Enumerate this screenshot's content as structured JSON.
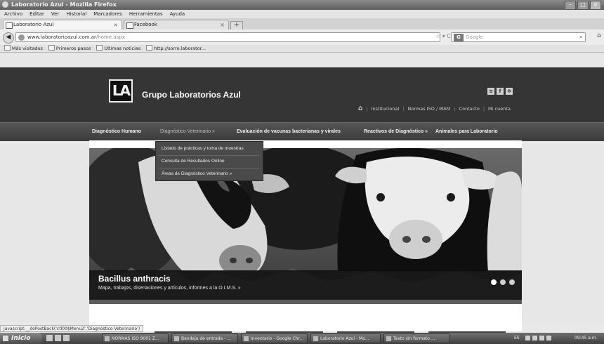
{
  "window": {
    "title": "Laboratorio Azul - Mozilla Firefox"
  },
  "menu": [
    "Archivo",
    "Editar",
    "Ver",
    "Historial",
    "Marcadores",
    "Herramientas",
    "Ayuda"
  ],
  "tabs": [
    {
      "label": "Laboratorio Azul"
    },
    {
      "label": "Facebook"
    }
  ],
  "address": {
    "host": "www.laboratorioazul.com.ar",
    "path": "/home.aspx"
  },
  "search": {
    "placeholder": "Google",
    "engine": "G"
  },
  "bookmarks": [
    "Más visitados",
    "Primeros pasos",
    "Últimas noticias",
    "http://sorro.laborator..."
  ],
  "site": {
    "brand": "Grupo Laboratorios Azul",
    "logo": "LA",
    "top_links": [
      "Institucional",
      "Normas ISO / IRAM",
      "Contacto",
      "Mi cuenta"
    ],
    "nav": [
      "Diagnóstico Humano",
      "Diagnóstico Veterinario »",
      "Evaluación de vacunas bacterianas y virales",
      "Reactivos de Diagnóstico »",
      "Animales para Laboratorio"
    ],
    "dropdown": [
      "Listado de prácticas y toma de muestras",
      "Consulta de Resultados Online",
      "Áreas de Diagnóstico Veterinario »"
    ],
    "slide": {
      "title": "Bacillus anthracis",
      "subtitle": "Mapa, trabajos, disertaciones y artículos, informes a la O.I.M.S. »",
      "dots": 3,
      "active_dot": 1
    }
  },
  "status": {
    "text": "javascript:__doPostBack('ctl00$Menu2','Diagnóstico Veterinario')"
  },
  "taskbar": {
    "start": "Inicio",
    "buttons": [
      "NORMAS ISO 9001 Z...",
      "Bandeja de entrada - ...",
      "Inventario - Google Chr...",
      "Laboratorio Azul - Mo...",
      "Texto sin formato ..."
    ],
    "tray": {
      "lang": "ES",
      "clock": "09:45 a.m."
    }
  },
  "colors": {
    "header": "#353535",
    "nav": "#454545",
    "page": "#e7e7e7"
  }
}
